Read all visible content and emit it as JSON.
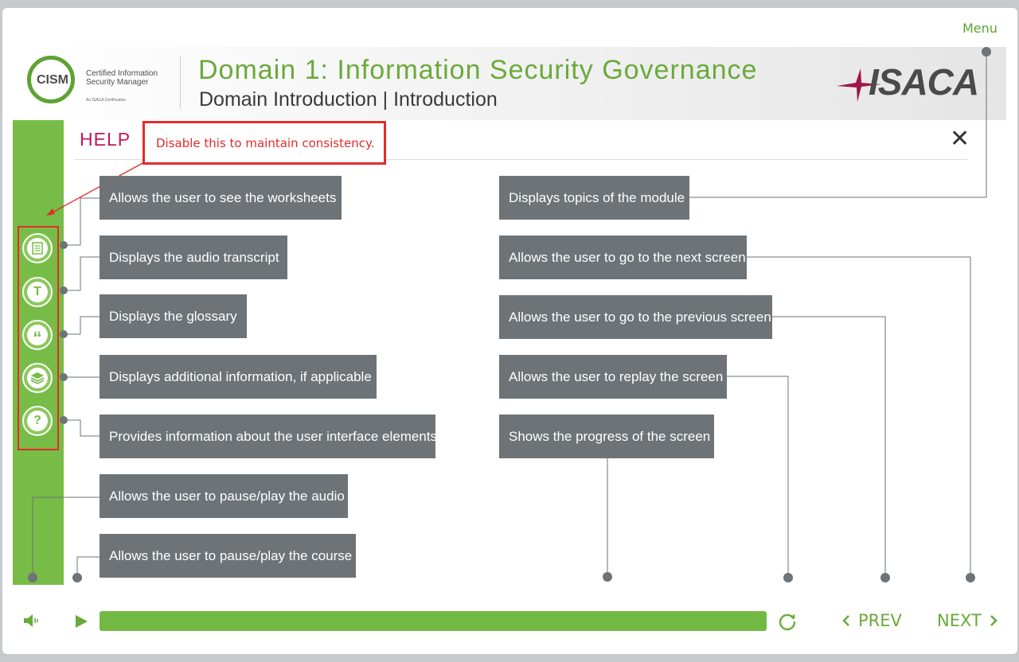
{
  "menu": {
    "label": "Menu"
  },
  "header": {
    "cism_abbr": "CISM",
    "cism_name": "Certified Information Security Manager",
    "cism_tag": "An ISACA Certification",
    "title": "Domain 1: Information Security Governance",
    "subtitle": "Domain Introduction | Introduction",
    "brand": "ISACA"
  },
  "help": {
    "title": "HELP",
    "close_label": "✕",
    "callout": "Disable this to maintain consistency."
  },
  "labels": {
    "worksheets": "Allows the user to see the worksheets",
    "transcript": "Displays the audio transcript",
    "glossary": "Displays the glossary",
    "additional": "Displays additional information, if applicable",
    "ui_info": "Provides information about the user interface elements",
    "pause_audio": "Allows the user to pause/play the audio",
    "pause_course": "Allows the user to pause/play the course",
    "topics": "Displays topics of the module",
    "next": "Allows the user to go to the next screen",
    "previous": "Allows the user to go to the previous screen",
    "replay": "Allows the user to replay the screen",
    "progress": "Shows the progress of the screen"
  },
  "sidebar": {
    "icons": [
      "worksheet-icon",
      "transcript-icon",
      "glossary-icon",
      "layers-icon",
      "help-icon"
    ],
    "glyphs": {
      "transcript": "T",
      "glossary": "“",
      "help": "?"
    }
  },
  "footer": {
    "prev_label": "PREV",
    "next_label": "NEXT",
    "progress_fraction": 1.0
  },
  "colors": {
    "accent_green": "#77bc46",
    "title_green": "#6aaa3a",
    "help_magenta": "#c2185b",
    "callout_red": "#e32b2b",
    "label_gray": "#6d7377"
  }
}
